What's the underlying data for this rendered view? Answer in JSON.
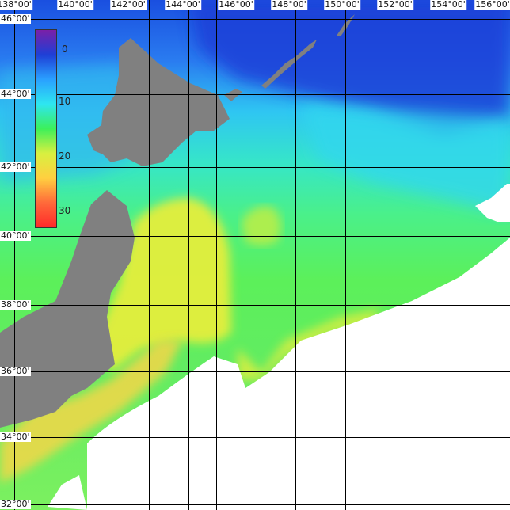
{
  "map": {
    "longitude_labels": [
      "138°00'",
      "140°00'",
      "142°00'",
      "144°00'",
      "146°00'",
      "148°00'",
      "150°00'",
      "152°00'",
      "154°00'",
      "156°00'"
    ],
    "latitude_labels": [
      "46°00'",
      "44°00'",
      "42°00'",
      "40°00'",
      "38°00'",
      "36°00'",
      "34°00'",
      "32°00'"
    ],
    "legend": {
      "labels": [
        "0",
        "10",
        "20",
        "30"
      ],
      "colors": [
        "#7a1fa8",
        "#1e3fd6",
        "#2aa0ff",
        "#2ee6f0",
        "#3cf05a",
        "#d8f040",
        "#ffd040",
        "#ff6a3a",
        "#ff2a2a"
      ]
    },
    "colors": {
      "land": "#808080",
      "no_data": "#ffffff",
      "grid": "#000000"
    }
  }
}
